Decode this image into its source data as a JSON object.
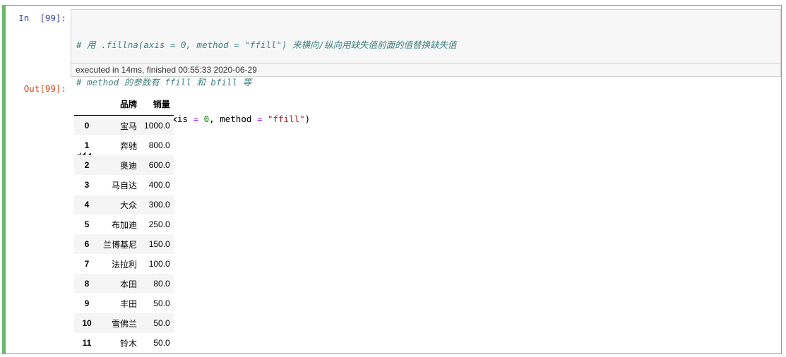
{
  "cell": {
    "in_prompt": "In  [99]:",
    "out_prompt": "Out[99]:",
    "exec_info": "executed in 14ms, finished 00:55:33 2020-06-29",
    "code_lines": [
      "# 用 .fillna(axis = 0, method = \"ffill\") 来横向/纵向用缺失值前面的值替换缺失值",
      "# method 的参数有 ffill 和 bfill 等",
      "df4 = df4.fillna(axis = 0, method = \"ffill\")",
      "df4"
    ]
  },
  "code_tokens": {
    "l3_a": "df4 ",
    "l3_eq": "=",
    "l3_b": " df4.fillna(axis ",
    "l3_eq2": "=",
    "l3_sp": " ",
    "l3_zero": "0",
    "l3_c": ", method ",
    "l3_eq3": "=",
    "l3_sp2": " ",
    "l3_str": "\"ffill\"",
    "l3_end": ")"
  },
  "table": {
    "columns": [
      "",
      "品牌",
      "销量"
    ],
    "rows": [
      {
        "index": "0",
        "brand": "宝马",
        "sales": "1000.0"
      },
      {
        "index": "1",
        "brand": "奔驰",
        "sales": "800.0"
      },
      {
        "index": "2",
        "brand": "奥迪",
        "sales": "600.0"
      },
      {
        "index": "3",
        "brand": "马自达",
        "sales": "400.0"
      },
      {
        "index": "4",
        "brand": "大众",
        "sales": "300.0"
      },
      {
        "index": "5",
        "brand": "布加迪",
        "sales": "250.0"
      },
      {
        "index": "6",
        "brand": "兰博基尼",
        "sales": "150.0"
      },
      {
        "index": "7",
        "brand": "法拉利",
        "sales": "100.0"
      },
      {
        "index": "8",
        "brand": "本田",
        "sales": "80.0"
      },
      {
        "index": "9",
        "brand": "丰田",
        "sales": "50.0"
      },
      {
        "index": "10",
        "brand": "雪佛兰",
        "sales": "50.0"
      },
      {
        "index": "11",
        "brand": "铃木",
        "sales": "50.0"
      }
    ]
  },
  "colors": {
    "cell_border": "#66bb6a",
    "in_prompt": "#303f9f",
    "out_prompt": "#d84315"
  }
}
